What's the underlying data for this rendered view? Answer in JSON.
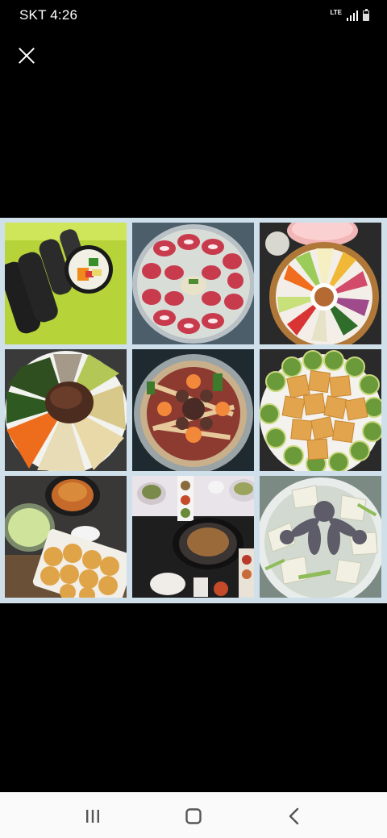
{
  "status_bar": {
    "carrier_time": "SKT 4:26",
    "network": "LTE",
    "icons": [
      "lte-icon",
      "signal-icon",
      "battery-icon"
    ]
  },
  "viewer": {
    "close_icon": "close-icon",
    "background_color": "#000000",
    "frame_color": "#cfe0ea"
  },
  "photo": {
    "tiles": [
      {
        "name": "gimbap-tile",
        "icon": "gimbap-photo"
      },
      {
        "name": "beef-rolls-tile",
        "icon": "beef-rolls-photo"
      },
      {
        "name": "platter-tile",
        "icon": "platter-photo"
      },
      {
        "name": "bibimbap-tile",
        "icon": "bibimbap-photo"
      },
      {
        "name": "hotpot-tile",
        "icon": "hotpot-photo"
      },
      {
        "name": "zucchini-jeon-tile",
        "icon": "zucchini-jeon-photo"
      },
      {
        "name": "pancakes-tile",
        "icon": "pancakes-photo"
      },
      {
        "name": "table-tile",
        "icon": "table-spread-photo"
      },
      {
        "name": "octopus-soup-tile",
        "icon": "octopus-soup-photo"
      }
    ]
  },
  "nav_bar": {
    "icons": [
      "recent-apps-icon",
      "home-icon",
      "back-icon"
    ]
  }
}
